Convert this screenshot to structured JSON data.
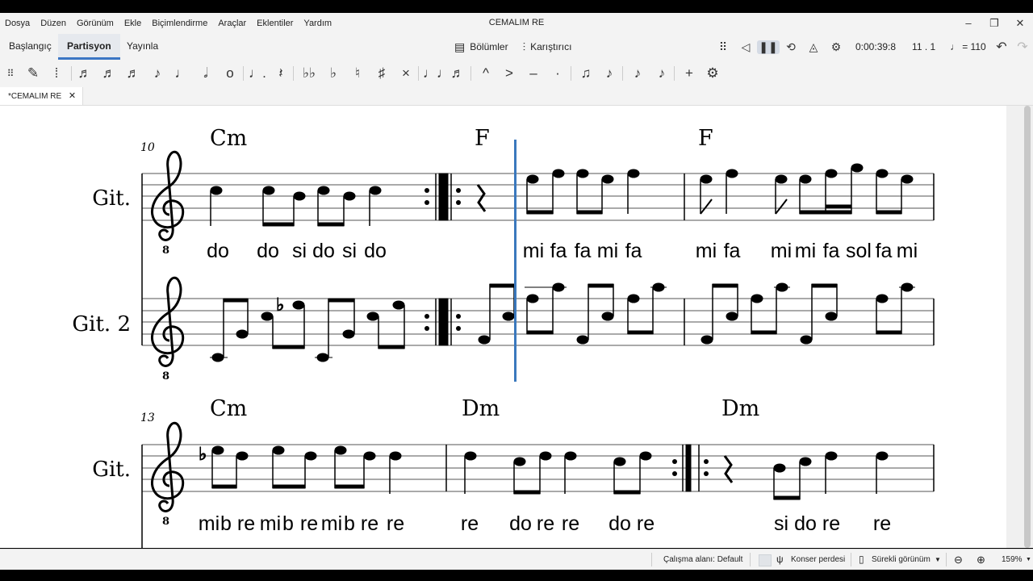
{
  "window": {
    "title": "CEMALIM RE",
    "controls": {
      "minimize": "–",
      "restore": "❐",
      "close": "✕"
    }
  },
  "menu": [
    "Dosya",
    "Düzen",
    "Görünüm",
    "Ekle",
    "Biçimlendirme",
    "Araçlar",
    "Eklentiler",
    "Yardım"
  ],
  "workspace_tabs": [
    "Başlangıç",
    "Partisyon",
    "Yayınla"
  ],
  "active_tab": "Partisyon",
  "header_buttons": {
    "parts": "Bölümler",
    "mixer": "Karıştırıcı"
  },
  "playback": {
    "time": "0:00:39:8",
    "position": "11 . 1",
    "tempo": "= 110",
    "tempo_note": "♩"
  },
  "document_tab": {
    "label": "*CEMALIM RE",
    "close": "✕"
  },
  "note_toolbar": {
    "icons": [
      "drag-handle-icon",
      "pencil-icon",
      "note-input-icon",
      "64th-note-icon",
      "32nd-note-icon",
      "16th-note-icon",
      "eighth-note-icon",
      "quarter-note-icon",
      "half-note-icon",
      "whole-note-icon",
      "augmentation-dot-icon",
      "rest-icon",
      "double-flat-icon",
      "flat-icon",
      "natural-icon",
      "sharp-icon",
      "double-sharp-icon",
      "tie-icon",
      "slur-icon",
      "marcato-icon",
      "accent-icon",
      "tenuto-icon",
      "staccato-icon",
      "tuplet-icon",
      "flip-direction-icon",
      "voice-1-icon",
      "voice-2-icon",
      "add-icon",
      "toolbar-settings-icon"
    ]
  },
  "score": {
    "systems": [
      {
        "measure_number": "10",
        "chords": [
          "Cm",
          "F",
          "F"
        ],
        "staves": [
          {
            "instrument": "Git.",
            "lyrics": [
              "do",
              "do",
              "si",
              "do",
              "si",
              "do",
              "mi",
              "fa",
              "fa",
              "mi",
              "fa",
              "mi",
              "fa",
              "mi",
              "mi",
              "fa",
              "sol",
              "fa",
              "mi"
            ]
          },
          {
            "instrument": "Git. 2"
          }
        ]
      },
      {
        "measure_number": "13",
        "chords": [
          "Cm",
          "Dm",
          "Dm"
        ],
        "staves": [
          {
            "instrument": "Git.",
            "lyrics": [
              "mi",
              "b",
              "re",
              "mi",
              "b",
              "re",
              "mi",
              "b",
              "re",
              "re",
              "re",
              "do",
              "re",
              "re",
              "do",
              "re",
              "si",
              "do",
              "re",
              "re"
            ]
          }
        ]
      }
    ]
  },
  "status": {
    "workspace": "Çalışma alanı: Default",
    "concert_pitch": "Konser perdesi",
    "view_mode": "Sürekli görünüm",
    "zoom": "159%"
  },
  "colors": {
    "playback_cursor": "#3a78bd",
    "active_tab_underline": "#3a75c4"
  }
}
